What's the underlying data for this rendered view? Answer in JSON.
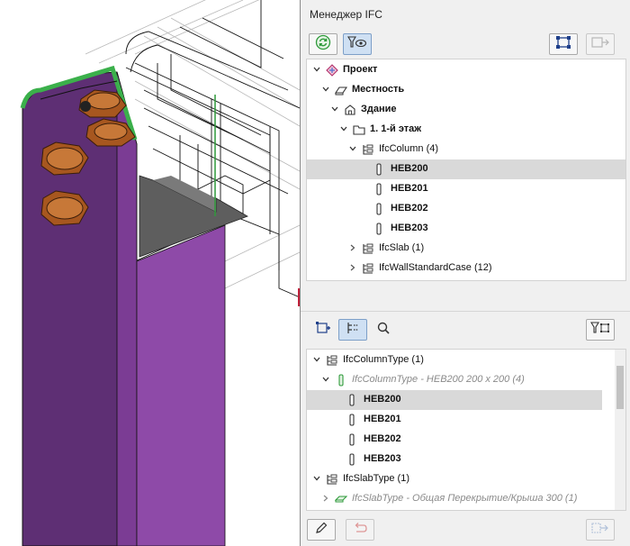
{
  "panel": {
    "title": "Менеджер IFC"
  },
  "top_tree": {
    "rows": [
      {
        "label": "Проект",
        "bold": true
      },
      {
        "label": "Местность",
        "bold": true
      },
      {
        "label": "Здание",
        "bold": true
      },
      {
        "label": "1. 1-й этаж",
        "bold": true
      },
      {
        "label": "IfcColumn (4)",
        "bold": false
      },
      {
        "label": "HEB200",
        "bold": true,
        "selected": true
      },
      {
        "label": "HEB201",
        "bold": true
      },
      {
        "label": "HEB202",
        "bold": true
      },
      {
        "label": "HEB203",
        "bold": true
      },
      {
        "label": "IfcSlab (1)",
        "bold": false
      },
      {
        "label": "IfcWallStandardCase (12)",
        "bold": false
      }
    ]
  },
  "bottom_tree": {
    "rows": [
      {
        "label": "IfcColumnType (1)"
      },
      {
        "label": "IfcColumnType - HEB200 200 x 200 (4)",
        "italic": true
      },
      {
        "label": "HEB200",
        "bold": true,
        "selected": true
      },
      {
        "label": "HEB201",
        "bold": true
      },
      {
        "label": "HEB202",
        "bold": true
      },
      {
        "label": "HEB203",
        "bold": true
      },
      {
        "label": "IfcSlabType (1)"
      },
      {
        "label": "IfcSlabType - Общая Перекрытие/Крыша 300 (1)",
        "italic": true
      }
    ]
  },
  "colors": {
    "accent_green": "#2e9a3a",
    "selection": "#d9d9d9",
    "column_purple": "#7a3c8f",
    "bolt_orange": "#b8652a"
  }
}
